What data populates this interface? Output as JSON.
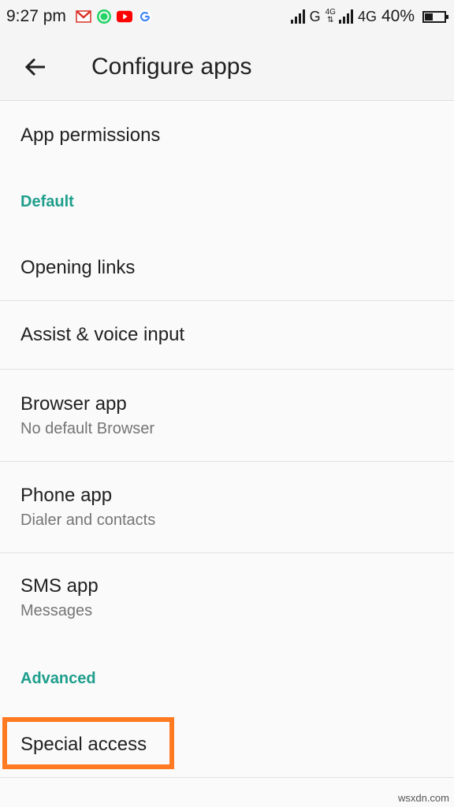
{
  "status_bar": {
    "time": "9:27 pm",
    "network_1": "G",
    "network_2_small": "4G",
    "network_2": "4G",
    "battery_percent": "40%",
    "battery_level": 0.4
  },
  "toolbar": {
    "title": "Configure apps"
  },
  "list": {
    "app_permissions": "App permissions",
    "section_default": "Default",
    "opening_links": "Opening links",
    "assist_voice": "Assist & voice input",
    "browser_app": {
      "title": "Browser app",
      "subtitle": "No default Browser"
    },
    "phone_app": {
      "title": "Phone app",
      "subtitle": "Dialer and contacts"
    },
    "sms_app": {
      "title": "SMS app",
      "subtitle": "Messages"
    },
    "section_advanced": "Advanced",
    "special_access": "Special access"
  },
  "colors": {
    "accent": "#1e9e8c",
    "highlight": "#ff7a21"
  },
  "watermark": "wsxdn.com"
}
